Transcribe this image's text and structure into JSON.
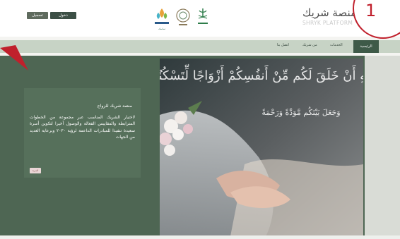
{
  "header": {
    "register_label": "تسجيل",
    "login_label": "دخول",
    "brand_title": "منصة شريك",
    "brand_subtitle": "SHRYK PLATFORM",
    "logos": [
      {
        "name": "tamasuk-logo",
        "caption": "تماسك"
      },
      {
        "name": "association-logo",
        "caption": ""
      },
      {
        "name": "ministry-logo",
        "caption": ""
      }
    ]
  },
  "nav": {
    "items": [
      "الرئيسية",
      "الخدمات",
      "من شريك",
      "اتصل بنا"
    ]
  },
  "card": {
    "title": "منصة شريك للزواج",
    "text": "لاختيار الشريك المناسب عبر مجموعة من الخطوات المترابطة والمقاييس الفعالة والوصول أخيرا لتكوين أسرة سعيدة تنفيذا للمبادرات الداعمة لرؤية ٢٠٣٠ وبرعاية العديد من الجهات",
    "button_label": "المزيد"
  },
  "hero": {
    "calligraphy_top": "وَمِنْ آيَاتِهِ أَنْ خَلَقَ لَكُم مِّنْ أَنفُسِكُمْ أَزْوَاجًا لِّتَسْكُنُوا إِلَيْهَا",
    "calligraphy_bottom": "وَجَعَلَ بَيْنَكُم مَّوَدَّةً وَرَحْمَةً"
  },
  "annotation": {
    "number": "1",
    "color": "#c0202c"
  },
  "colors": {
    "primary": "#3e5a48",
    "hero_bg": "#4e6653",
    "nav_bg": "#c7d3c5"
  }
}
